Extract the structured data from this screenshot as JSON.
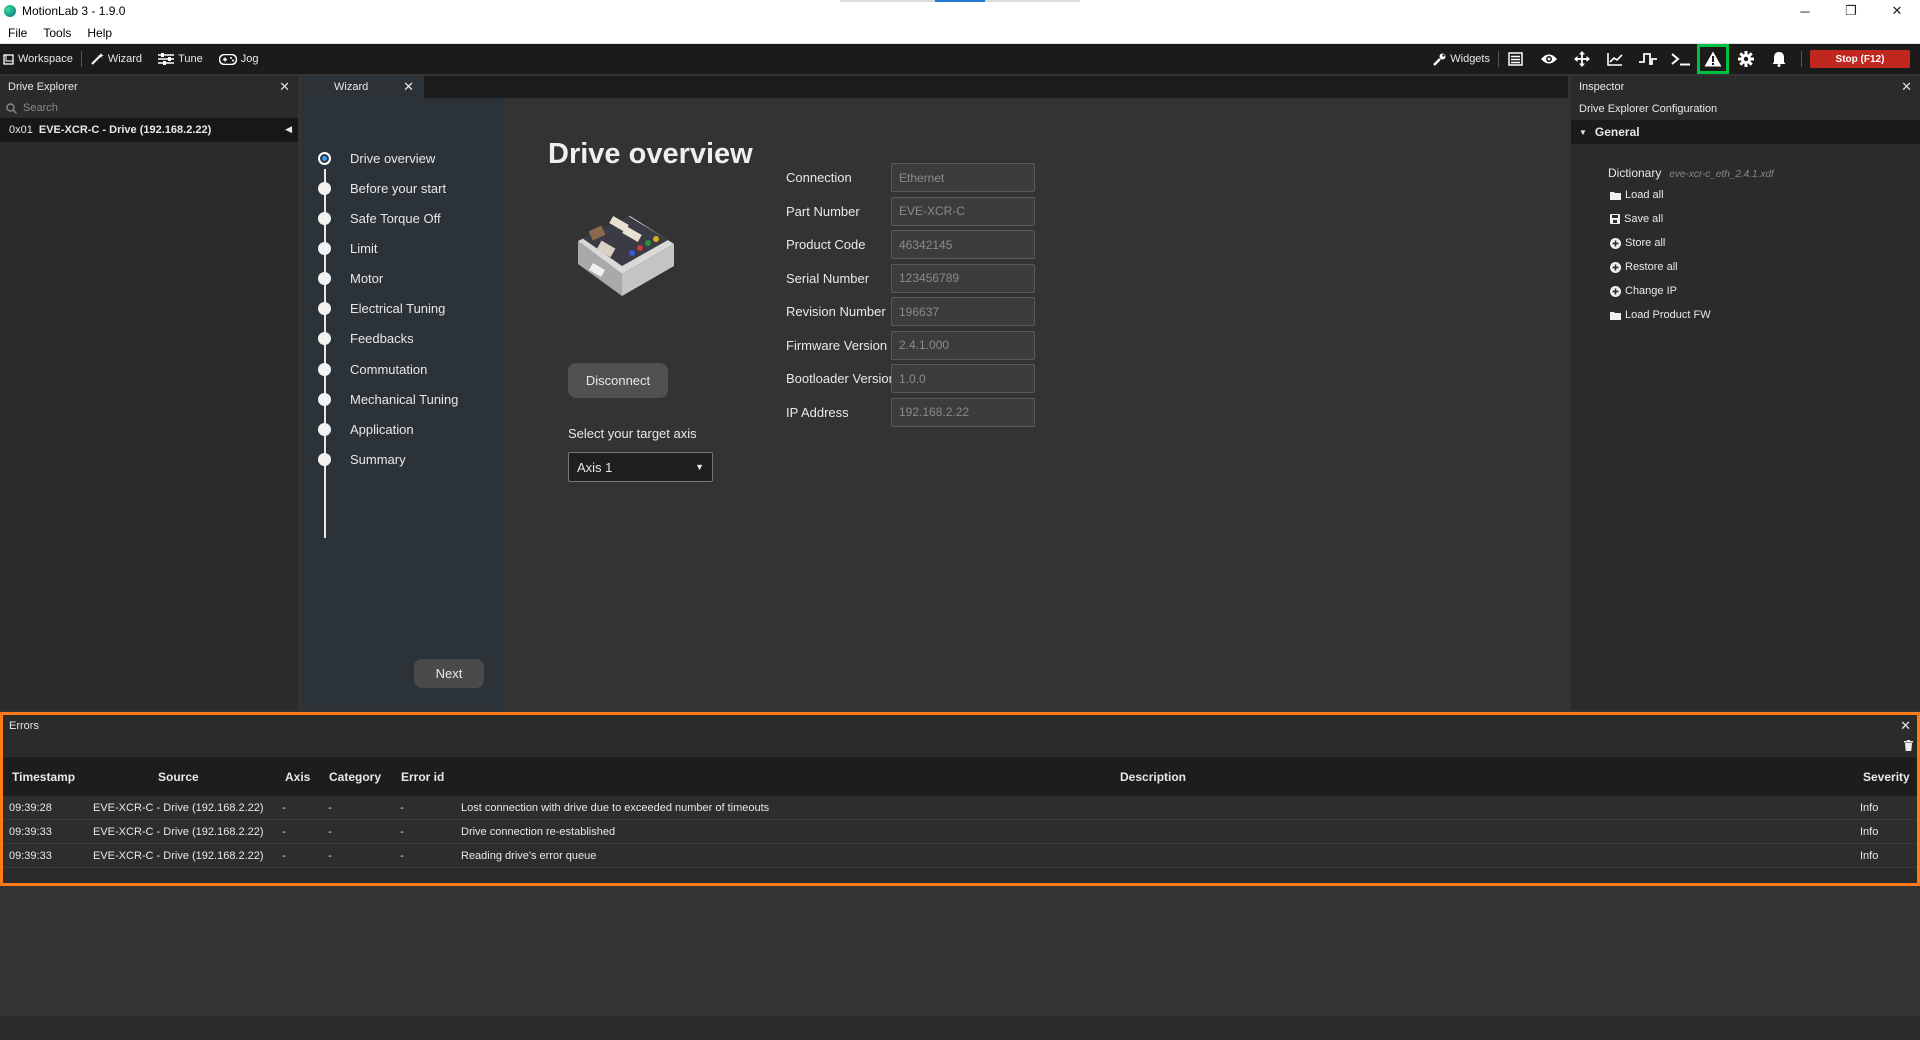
{
  "window": {
    "title": "MotionLab 3 - 1.9.0",
    "minimize": "─",
    "restore": "❐",
    "close": "✕"
  },
  "menu": [
    "File",
    "Tools",
    "Help"
  ],
  "toolbar": {
    "workspace": "Workspace",
    "wizard": "Wizard",
    "tune": "Tune",
    "jog": "Jog",
    "widgets": "Widgets",
    "stop": "Stop (F12)",
    "highlight_color": "#00c040"
  },
  "drive_explorer": {
    "title": "Drive Explorer",
    "search_placeholder": "Search",
    "drive_addr": "0x01",
    "drive_name": "EVE-XCR-C - Drive (192.168.2.22)"
  },
  "wizard": {
    "tab_title": "Wizard",
    "steps": [
      "Drive overview",
      "Before your start",
      "Safe Torque Off",
      "Limit",
      "Motor",
      "Electrical Tuning",
      "Feedbacks",
      "Commutation",
      "Mechanical Tuning",
      "Application",
      "Summary"
    ],
    "active_step": "Drive overview",
    "next": "Next",
    "heading": "Drive overview",
    "disconnect": "Disconnect",
    "axis_label": "Select your target axis",
    "axis_value": "Axis 1",
    "fields": [
      {
        "label": "Connection",
        "value": "Ethernet"
      },
      {
        "label": "Part Number",
        "value": "EVE-XCR-C"
      },
      {
        "label": "Product Code",
        "value": "46342145"
      },
      {
        "label": "Serial Number",
        "value": "123456789"
      },
      {
        "label": "Revision Number",
        "value": "196637"
      },
      {
        "label": "Firmware Version",
        "value": "2.4.1.000"
      },
      {
        "label": "Bootloader Version",
        "value": "1.0.0"
      },
      {
        "label": "IP Address",
        "value": "192.168.2.22"
      }
    ]
  },
  "inspector": {
    "title": "Inspector",
    "subtitle": "Drive Explorer Configuration",
    "section": "General",
    "dictionary_label": "Dictionary",
    "dictionary_value": "eve-xcr-c_eth_2.4.1.xdf",
    "actions": [
      "Load all",
      "Save all",
      "Store all",
      "Restore all",
      "Change IP",
      "Load Product FW"
    ]
  },
  "errors": {
    "title": "Errors",
    "border_color": "#ff7a1a",
    "columns": [
      "Timestamp",
      "Source",
      "Axis",
      "Category",
      "Error id",
      "Description",
      "Severity"
    ],
    "rows": [
      [
        "09:39:28",
        "EVE-XCR-C - Drive (192.168.2.22)",
        "-",
        "-",
        "-",
        "Lost connection with drive due to exceeded number of timeouts",
        "Info"
      ],
      [
        "09:39:33",
        "EVE-XCR-C - Drive (192.168.2.22)",
        "-",
        "-",
        "-",
        "Drive connection re-established",
        "Info"
      ],
      [
        "09:39:33",
        "EVE-XCR-C - Drive (192.168.2.22)",
        "-",
        "-",
        "-",
        "Reading drive's error queue",
        "Info"
      ]
    ]
  }
}
